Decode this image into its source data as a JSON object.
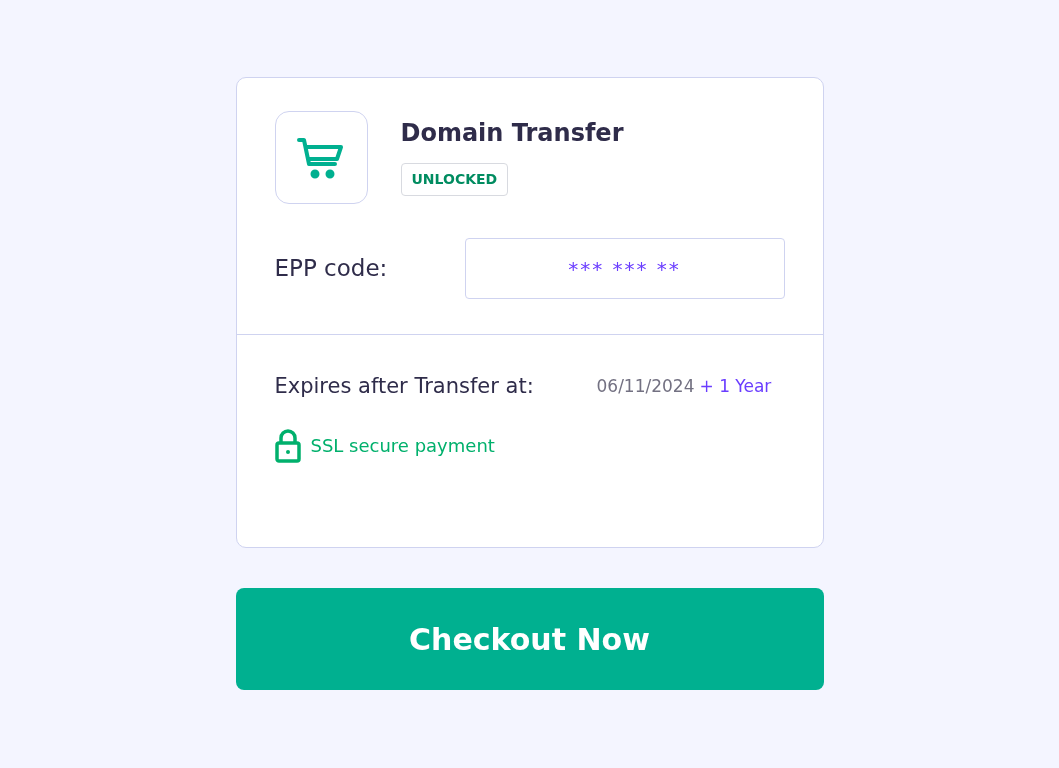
{
  "product": {
    "title": "Domain Transfer",
    "badge": "UNLOCKED"
  },
  "epp": {
    "label": "EPP code:",
    "value": "*** *** **"
  },
  "expiry": {
    "label": "Expires after Transfer at:",
    "date": "06/11/2024",
    "extension": "+ 1 Year"
  },
  "security": {
    "text": "SSL secure payment"
  },
  "checkout_button": "Checkout Now"
}
